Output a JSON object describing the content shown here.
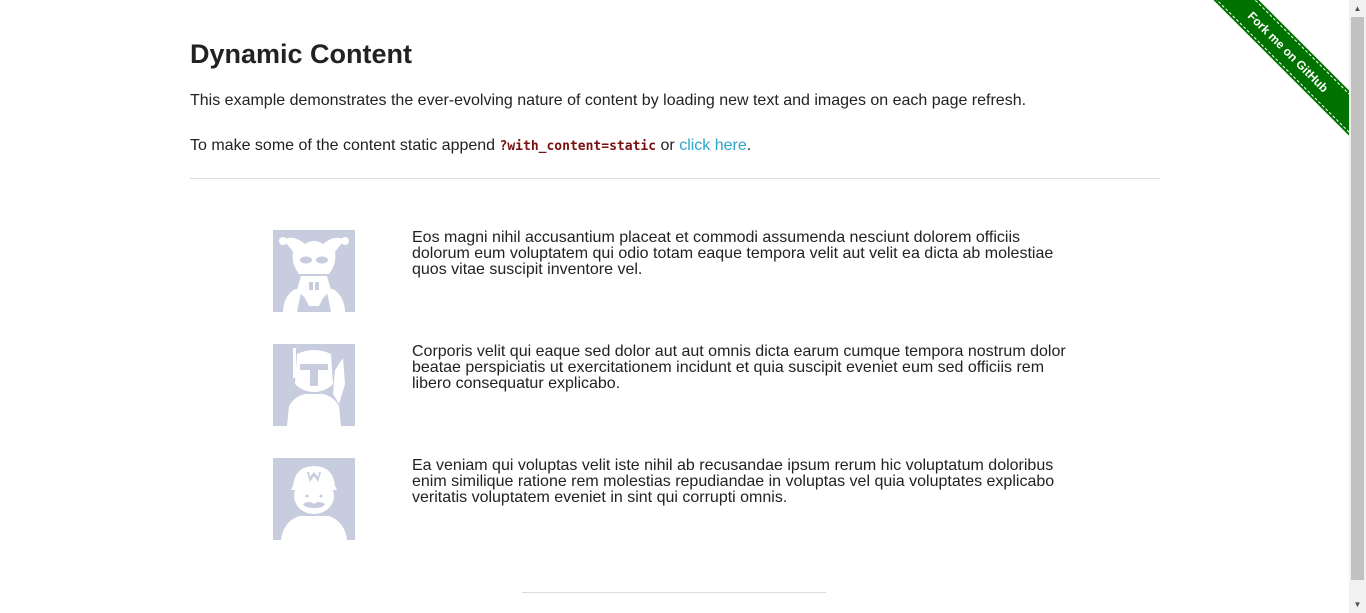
{
  "header": {
    "title": "Dynamic Content",
    "intro": "This example demonstrates the ever-evolving nature of content by loading new text and images on each page refresh.",
    "static_prefix": "To make some of the content static append ",
    "static_code": "?with_content=static",
    "static_mid": " or ",
    "static_link": "click here",
    "static_suffix": "."
  },
  "rows": [
    {
      "avatar_icon": "jester-avatar-icon",
      "text": "Eos magni nihil accusantium placeat et commodi assumenda nesciunt dolorem officiis dolorum eum voluptatem qui odio totam eaque tempora velit aut velit ea dicta ab molestiae quos vitae suscipit inventore vel."
    },
    {
      "avatar_icon": "helmet-avatar-icon",
      "text": "Corporis velit qui eaque sed dolor aut aut omnis dicta earum cumque tempora nostrum dolor beatae perspiciatis ut exercitationem incidunt et quia suscipit eveniet eum sed officiis rem libero consequatur explicabo."
    },
    {
      "avatar_icon": "plumber-avatar-icon",
      "text": "Ea veniam qui voluptas velit iste nihil ab recusandae ipsum rerum hic voluptatum doloribus enim similique ratione rem molestias repudiandae in voluptas vel quia voluptates explicabo veritatis voluptatem eveniet in sint qui corrupti omnis."
    }
  ],
  "ribbon": {
    "label": "Fork me on GitHub",
    "color": "#007200"
  },
  "colors": {
    "link": "#2ba6cb",
    "code": "#7a0f0f",
    "avatar_bg": "#c7ccdf"
  }
}
